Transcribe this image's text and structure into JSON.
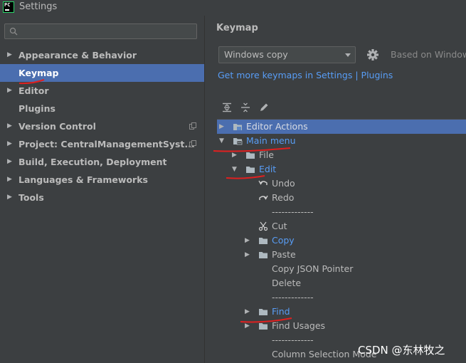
{
  "window": {
    "title": "Settings",
    "app_icon_text": "PC"
  },
  "sidebar": {
    "search_placeholder": "",
    "items": [
      {
        "label": "Appearance & Behavior",
        "expandable": true,
        "selected": false
      },
      {
        "label": "Keymap",
        "expandable": false,
        "selected": true
      },
      {
        "label": "Editor",
        "expandable": true,
        "selected": false
      },
      {
        "label": "Plugins",
        "expandable": false,
        "selected": false
      },
      {
        "label": "Version Control",
        "expandable": true,
        "selected": false
      },
      {
        "label": "Project: CentralManagementSyst...",
        "expandable": true,
        "selected": false
      },
      {
        "label": "Build, Execution, Deployment",
        "expandable": true,
        "selected": false
      },
      {
        "label": "Languages & Frameworks",
        "expandable": true,
        "selected": false
      },
      {
        "label": "Tools",
        "expandable": true,
        "selected": false
      }
    ]
  },
  "main": {
    "title": "Keymap",
    "keymap_select": "Windows copy",
    "based_on": "Based on Windows",
    "link": "Get more keymaps in Settings | Plugins",
    "toolbar": [
      "expand-all-icon",
      "collapse-all-icon",
      "edit-icon"
    ],
    "tree": [
      {
        "label": "Editor Actions",
        "icon": "actions-folder-icon",
        "arrow": "right",
        "blue": false,
        "selected": true
      },
      {
        "label": "Main menu",
        "icon": "menu-folder-icon",
        "arrow": "down",
        "blue": true,
        "selected": false
      },
      {
        "label": "File",
        "icon": "folder-icon",
        "arrow": "right",
        "blue": false,
        "selected": false
      },
      {
        "label": "Edit",
        "icon": "folder-icon",
        "arrow": "down",
        "blue": true,
        "selected": false
      },
      {
        "label": "Undo",
        "icon": "undo-icon",
        "arrow": "",
        "blue": false,
        "selected": false
      },
      {
        "label": "Redo",
        "icon": "redo-icon",
        "arrow": "",
        "blue": false,
        "selected": false
      },
      {
        "label": "-------------",
        "icon": "",
        "arrow": "",
        "blue": false,
        "selected": false
      },
      {
        "label": "Cut",
        "icon": "scissors-icon",
        "arrow": "",
        "blue": false,
        "selected": false
      },
      {
        "label": "Copy",
        "icon": "folder-icon",
        "arrow": "right",
        "blue": true,
        "selected": false
      },
      {
        "label": "Paste",
        "icon": "folder-icon",
        "arrow": "right",
        "blue": false,
        "selected": false
      },
      {
        "label": "Copy JSON Pointer",
        "icon": "",
        "arrow": "",
        "blue": false,
        "selected": false
      },
      {
        "label": "Delete",
        "icon": "",
        "arrow": "",
        "blue": false,
        "selected": false
      },
      {
        "label": "-------------",
        "icon": "",
        "arrow": "",
        "blue": false,
        "selected": false
      },
      {
        "label": "Find",
        "icon": "folder-icon",
        "arrow": "right",
        "blue": true,
        "selected": false
      },
      {
        "label": "Find Usages",
        "icon": "folder-icon",
        "arrow": "right",
        "blue": false,
        "selected": false
      },
      {
        "label": "-------------",
        "icon": "",
        "arrow": "",
        "blue": false,
        "selected": false
      },
      {
        "label": "Column Selection Mode",
        "icon": "",
        "arrow": "",
        "blue": false,
        "selected": false
      }
    ]
  },
  "watermark": "CSDN @东林牧之",
  "colors": {
    "selection": "#4b6eaf",
    "link": "#589df6",
    "annotation": "#e02020"
  }
}
